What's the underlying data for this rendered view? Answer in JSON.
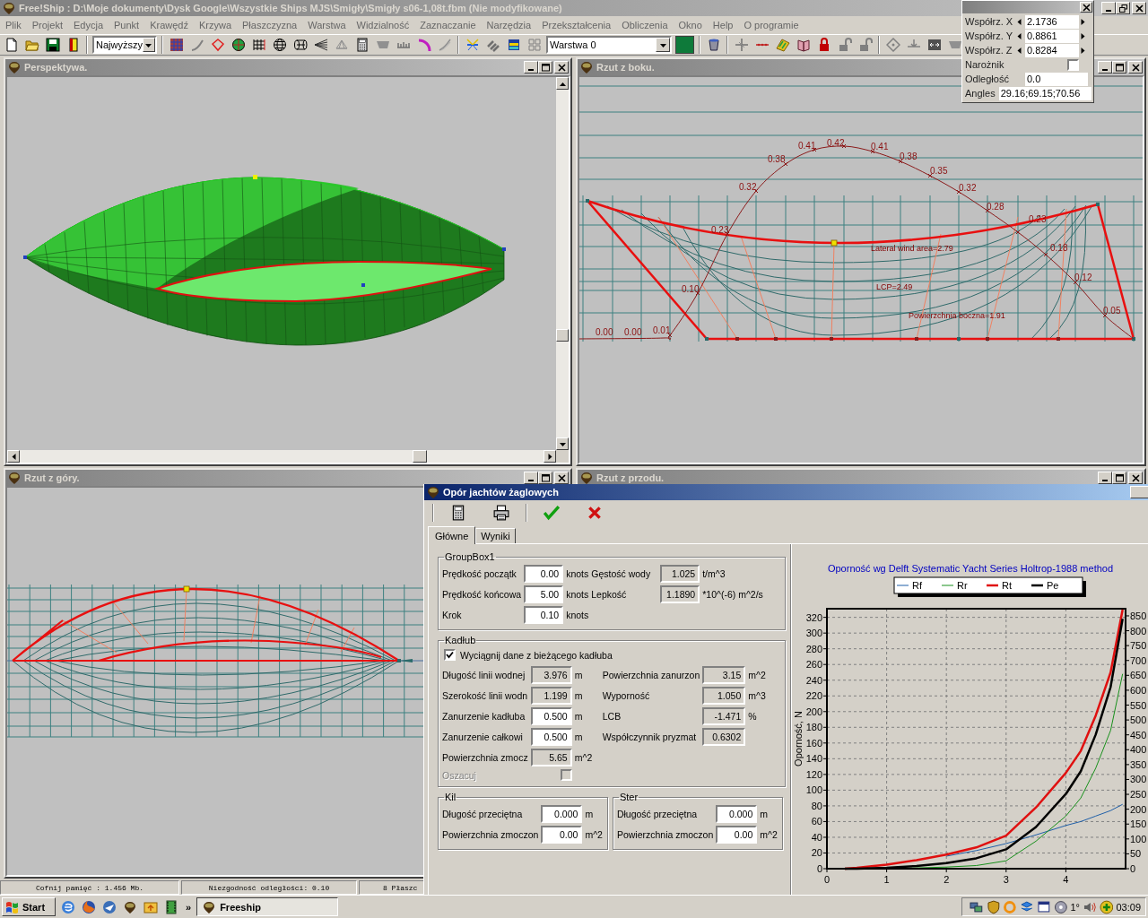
{
  "app_window": {
    "title": "Free!Ship : D:\\Moje dokumenty\\Dysk Google\\Wszystkie Ships MJS\\Smigły\\Smigły s06-1,08t.fbm (Nie modyfikowane)"
  },
  "menu": [
    "Plik",
    "Projekt",
    "Edycja",
    "Punkt",
    "Krawędź",
    "Krzywa",
    "Płaszczyzna",
    "Warstwa",
    "Widzialność",
    "Zaznaczanie",
    "Narzędzia",
    "Przekształcenia",
    "Obliczenia",
    "Okno",
    "Help",
    "O programie"
  ],
  "toolbar": {
    "precision": "Najwyższy",
    "layer": "Warstwa 0"
  },
  "coordinate_panel": {
    "fields": [
      {
        "kind": "spin",
        "label": "Współrz. X",
        "value": "2.1736"
      },
      {
        "kind": "spin",
        "label": "Współrz. Y",
        "value": "0.8861"
      },
      {
        "kind": "spin",
        "label": "Współrz. Z",
        "value": "0.8284"
      },
      {
        "kind": "checkbox",
        "label": "Narożnik",
        "checked": false
      },
      {
        "kind": "field",
        "label": "Odległość",
        "value": "0.0"
      },
      {
        "kind": "wide_field",
        "label": "Angles",
        "value": "29.16;69.15;70.56"
      }
    ]
  },
  "views": [
    {
      "kind": "perspective",
      "title": "Perspektywa."
    },
    {
      "kind": "side",
      "title": "Rzut z boku.",
      "curve_labels": [
        "0.00",
        "0.00",
        "0.01",
        "0.10",
        "0.23",
        "0.32",
        "0.38",
        "0.41",
        "0.42",
        "0.41",
        "0.38",
        "0.35",
        "0.32",
        "0.28",
        "0.23",
        "0.18",
        "0.12",
        "0.05"
      ],
      "annotations": [
        "Lateral wind area=2.79",
        "LCP=2.49",
        "Powierzchnia boczna=1.91"
      ]
    },
    {
      "kind": "top",
      "title": "Rzut z góry."
    },
    {
      "kind": "front",
      "title": "Rzut z przodu."
    }
  ],
  "status_bar": [
    "Cofnij pamięć : 1.456 Mb.",
    "Niezgodność odległości: 0.10",
    "8 Płaszc"
  ],
  "dialog": {
    "title": "Opór jachtów żaglowych",
    "tabs": [
      {
        "label": "Główne",
        "selected": true
      },
      {
        "label": "Wyniki",
        "selected": false
      }
    ],
    "speed_group": {
      "title": "GroupBox1",
      "rows": [
        {
          "label": "Prędkość początk",
          "value": "0.00",
          "editable": true,
          "unit": "knots",
          "param": {
            "label": "Gęstość wody",
            "value": "1.025",
            "editable": false,
            "unit": "t/m^3"
          }
        },
        {
          "label": "Prędkość końcowa",
          "value": "5.00",
          "editable": true,
          "unit": "knots",
          "param": {
            "label": "Lepkość",
            "value": "1.1890",
            "editable": false,
            "unit": "*10^(-6) m^2/s"
          }
        },
        {
          "label": "Krok",
          "value": "0.10",
          "editable": true,
          "unit": "knots"
        }
      ]
    },
    "hull_group": {
      "title": "Kadłub",
      "use_current": {
        "label": "Wyciągnij dane z bieżącego kadłuba",
        "checked": true
      },
      "left_fields": [
        {
          "label": "Długość linii wodnej",
          "value": "3.976",
          "editable": false,
          "unit": "m"
        },
        {
          "label": "Szerokość linii wodn",
          "value": "1.199",
          "editable": false,
          "unit": "m"
        },
        {
          "label": "Zanurzenie kadłuba",
          "value": "0.500",
          "editable": true,
          "unit": "m"
        },
        {
          "label": "Zanurzenie całkowi",
          "value": "0.500",
          "editable": true,
          "unit": "m"
        },
        {
          "label": "Powierzchnia zmocz",
          "value": "5.65",
          "editable": false,
          "unit": "m^2"
        }
      ],
      "right_fields": [
        {
          "label": "Powierzchnia zanurzon",
          "value": "3.15",
          "editable": false,
          "unit": "m^2"
        },
        {
          "label": "Wyporność",
          "value": "1.050",
          "editable": false,
          "unit": "m^3"
        },
        {
          "label": "LCB",
          "value": "-1.471",
          "editable": false,
          "unit": "%"
        },
        {
          "label": "Współczynnik pryzmat",
          "value": "0.6302",
          "editable": false
        }
      ],
      "estimate": {
        "label": "Oszacuj",
        "checked": false,
        "disabled": true
      }
    },
    "keel_group": {
      "title": "Kil",
      "fields": [
        {
          "label": "Długość przeciętna",
          "value": "0.000",
          "editable": true,
          "unit": "m"
        },
        {
          "label": "Powierzchnia zmoczon",
          "value": "0.00",
          "editable": true,
          "unit": "m^2"
        }
      ]
    },
    "rudder_group": {
      "title": "Ster",
      "fields": [
        {
          "label": "Długość przeciętna",
          "value": "0.000",
          "editable": true,
          "unit": "m"
        },
        {
          "label": "Powierzchnia zmoczon",
          "value": "0.00",
          "editable": true,
          "unit": "m^2"
        }
      ]
    },
    "chart": {
      "chart_data": {
        "type": "line",
        "title": "Oporność wg Delft Systematic Yacht Series Holtrop-1988 method",
        "ylabel": "Oporność, N",
        "x": [
          0.3,
          0.5,
          1,
          1.5,
          2,
          2.5,
          3,
          3.5,
          4,
          4.25,
          4.5,
          4.75,
          4.95
        ],
        "xlim": [
          0,
          5
        ],
        "ylim": [
          0,
          331
        ],
        "y2lim": [
          0,
          874
        ],
        "grid": true,
        "legend": "top",
        "xticks": [
          0,
          1,
          2,
          3,
          4
        ],
        "yticks": [
          0,
          20,
          40,
          60,
          80,
          100,
          120,
          140,
          160,
          180,
          200,
          220,
          240,
          260,
          280,
          300,
          320
        ],
        "y2ticks": [
          0,
          50,
          100,
          150,
          200,
          250,
          300,
          350,
          400,
          450,
          500,
          550,
          600,
          650,
          700,
          750,
          800,
          850
        ],
        "series": [
          {
            "name": "Rf",
            "color": "#1f5fa8",
            "values": [
              null,
              null,
              null,
              null,
              16,
              23,
              32,
              43,
              55,
              60,
              67,
              74,
              82
            ]
          },
          {
            "name": "Rr",
            "color": "#18901c",
            "values": [
              null,
              null,
              0,
              1,
              2,
              4,
              10,
              35,
              67,
              90,
              128,
              176,
              248
            ]
          },
          {
            "name": "Rt",
            "color": "#e01010",
            "values": [
              0,
              1,
              5,
              11,
              18,
              27,
              42,
              78,
              122,
              150,
              195,
              250,
              330
            ]
          },
          {
            "name": "Pe",
            "color": "#000000",
            "axis": "y2",
            "values": [
              0,
              0,
              3,
              9,
              19,
              35,
              65,
              140,
              251,
              328,
              451,
              611,
              840
            ]
          }
        ]
      }
    }
  },
  "taskbar": {
    "start": "Start",
    "overflow": "»",
    "tasks": [
      {
        "label": "Freeship",
        "selected": true
      }
    ],
    "temperature": "1°",
    "clock": "03:09"
  }
}
